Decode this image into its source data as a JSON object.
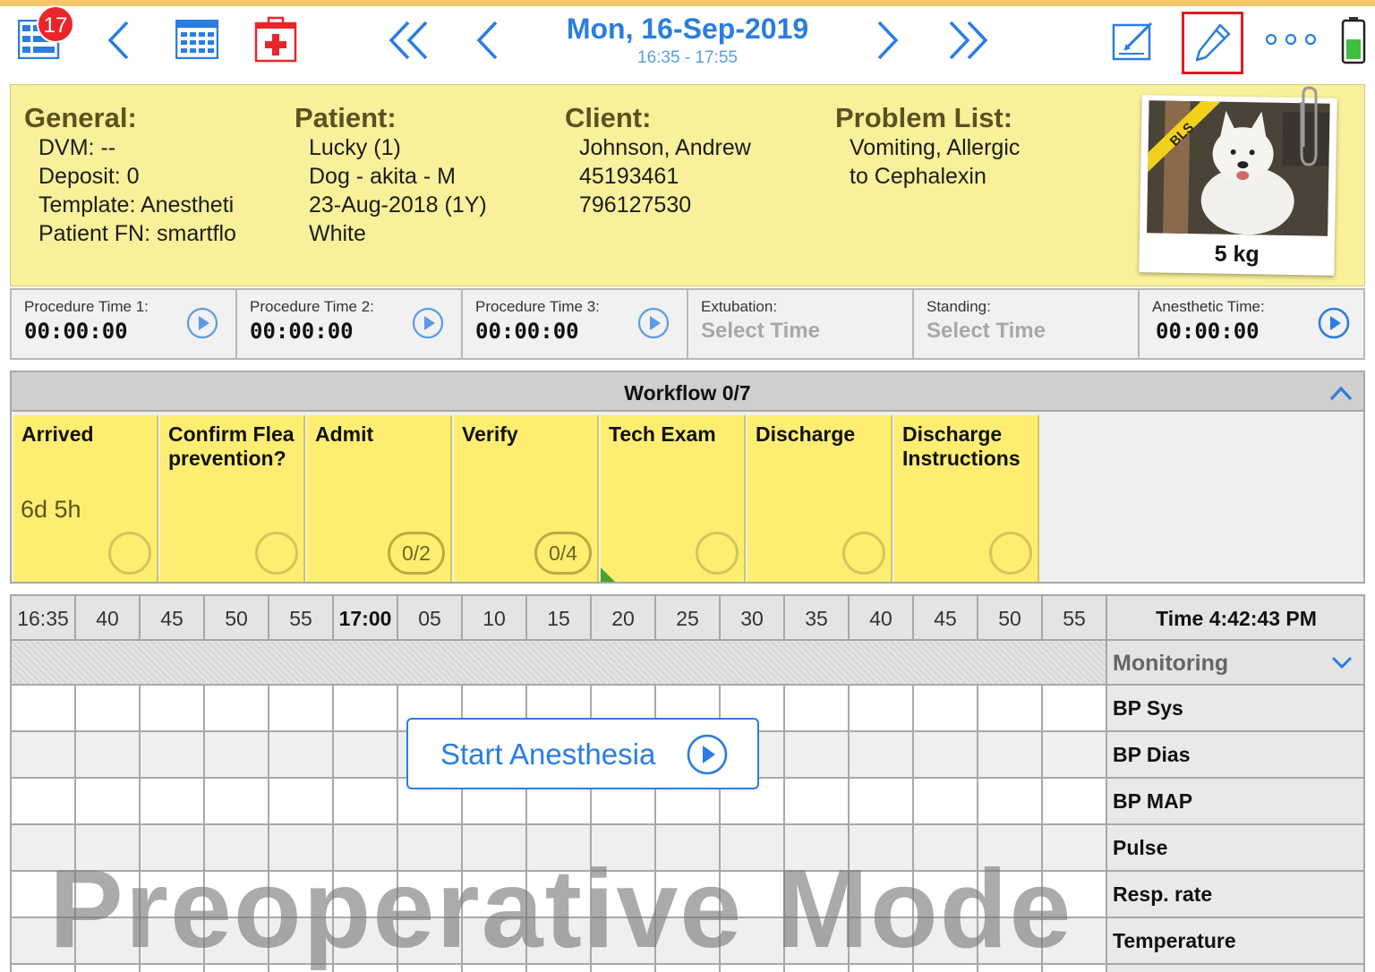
{
  "toolbar": {
    "badge_count": "17",
    "date": "Mon, 16-Sep-2019",
    "time_range": "16:35 - 17:55"
  },
  "info": {
    "general": {
      "heading": "General:",
      "lines": [
        "DVM: --",
        "Deposit: 0",
        "Template: Anestheti",
        "Patient FN: smartflo"
      ]
    },
    "patient": {
      "heading": "Patient:",
      "lines": [
        "Lucky (1)",
        "Dog - akita - M",
        "23-Aug-2018 (1Y)",
        "White"
      ]
    },
    "client": {
      "heading": "Client:",
      "lines": [
        "Johnson, Andrew",
        "45193461",
        "796127530"
      ]
    },
    "problems": {
      "heading": "Problem List:",
      "lines": [
        "Vomiting, Allergic",
        "to Cephalexin"
      ]
    },
    "photo": {
      "ribbon": "BLS",
      "weight": "5 kg"
    }
  },
  "timers": [
    {
      "label": "Procedure Time 1:",
      "value": "00:00:00",
      "placeholder": false
    },
    {
      "label": "Procedure Time 2:",
      "value": "00:00:00",
      "placeholder": false
    },
    {
      "label": "Procedure Time 3:",
      "value": "00:00:00",
      "placeholder": false
    },
    {
      "label": "Extubation:",
      "value": "Select Time",
      "placeholder": true
    },
    {
      "label": "Standing:",
      "value": "Select Time",
      "placeholder": true
    },
    {
      "label": "Anesthetic Time:",
      "value": "00:00:00",
      "placeholder": false
    }
  ],
  "workflow": {
    "title": "Workflow 0/7",
    "steps": [
      {
        "label": "Arrived",
        "extra": "6d 5h",
        "progress": ""
      },
      {
        "label": "Confirm Flea prevention?",
        "extra": "",
        "progress": ""
      },
      {
        "label": "Admit",
        "extra": "",
        "progress": "0/2"
      },
      {
        "label": "Verify",
        "extra": "",
        "progress": "0/4"
      },
      {
        "label": "Tech Exam",
        "extra": "",
        "progress": ""
      },
      {
        "label": "Discharge",
        "extra": "",
        "progress": ""
      },
      {
        "label": "Discharge Instructions",
        "extra": "",
        "progress": ""
      }
    ]
  },
  "timeline": {
    "ticks": [
      "16:35",
      "40",
      "45",
      "50",
      "55",
      "17:00",
      "05",
      "10",
      "15",
      "20",
      "25",
      "30",
      "35",
      "40",
      "45",
      "50",
      "55"
    ],
    "clock": "Time 4:42:43 PM",
    "monitoring_label": "Monitoring",
    "parameters": [
      "BP Sys",
      "BP Dias",
      "BP MAP",
      "Pulse",
      "Resp. rate",
      "Temperature"
    ],
    "start_button": "Start Anesthesia",
    "mode_watermark": "Preoperative Mode"
  }
}
